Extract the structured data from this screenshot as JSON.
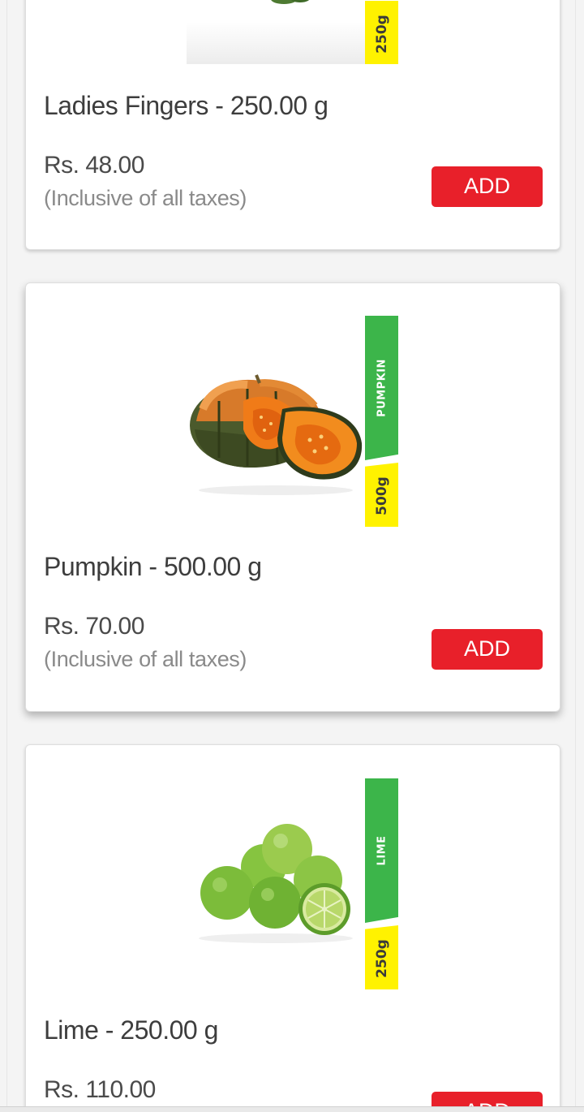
{
  "products": [
    {
      "title": "Ladies Fingers - 250.00 g",
      "image": "ladies-fingers-image",
      "weight_tag": "250g",
      "price": "Rs. 48.00",
      "tax_note": "(Inclusive of all taxes)",
      "add_label": "ADD"
    },
    {
      "title": "Pumpkin - 500.00 g",
      "image": "pumpkin-image",
      "name_tag": "PUMPKIN",
      "weight_tag": "500g",
      "price": "Rs. 70.00",
      "tax_note": "(Inclusive of all taxes)",
      "add_label": "ADD"
    },
    {
      "title": "Lime - 250.00 g",
      "image": "lime-image",
      "name_tag": "LIME",
      "weight_tag": "250g",
      "price": "Rs. 110.00",
      "add_label": "ADD"
    }
  ],
  "colors": {
    "add_button": "#e8202a",
    "name_tag": "#3cb54a",
    "weight_tag": "#fff200",
    "title_text": "#3d3d3d",
    "tax_text": "#8a8a8a"
  }
}
